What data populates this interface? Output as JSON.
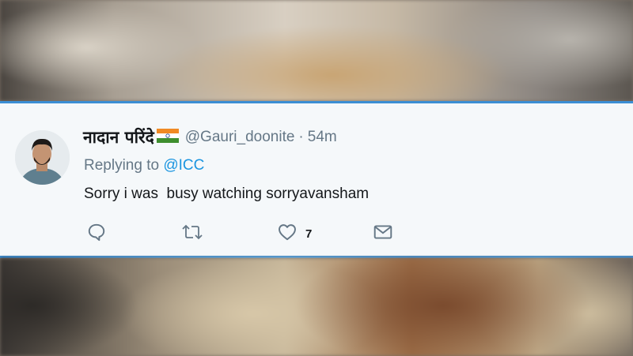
{
  "tweet": {
    "display_name": "नादान परिंदे",
    "flag_icon": "india-flag-icon",
    "handle": "@Gauri_doonite",
    "separator": "·",
    "time": "54m",
    "replying_prefix": "Replying to ",
    "replying_to": "@ICC",
    "text": "Sorry i was  busy watching sorryavansham"
  },
  "actions": {
    "reply_icon": "reply-icon",
    "retweet_icon": "retweet-icon",
    "like_icon": "heart-icon",
    "like_count": "7",
    "dm_icon": "envelope-icon"
  },
  "colors": {
    "border_accent": "#3b8ed4",
    "link": "#1b95e0",
    "muted_text": "#657786",
    "primary_text": "#14171a",
    "card_background": "#f5f8fa"
  }
}
